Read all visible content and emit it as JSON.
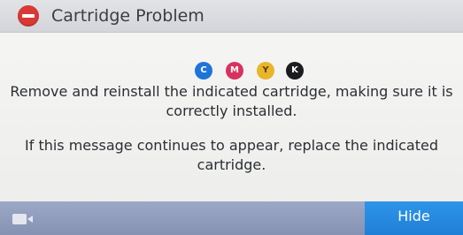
{
  "header": {
    "title": "Cartridge Problem",
    "icon": "error-minus-icon",
    "icon_color": "#d93a36"
  },
  "cartridges": [
    {
      "letter": "C",
      "color": "#1e74d8",
      "name": "cyan"
    },
    {
      "letter": "M",
      "color": "#d8325e",
      "name": "magenta"
    },
    {
      "letter": "Y",
      "color": "#e9b52a",
      "name": "yellow"
    },
    {
      "letter": "K",
      "color": "#1c1c1e",
      "name": "black"
    }
  ],
  "message": {
    "line1": "Remove and reinstall the indicated cartridge, making sure it is correctly installed.",
    "line2": "If this message continues to appear, replace the indicated cartridge."
  },
  "footer": {
    "left_icon": "video-camera-icon",
    "hide_label": "Hide",
    "accent": "#2e95e8"
  }
}
